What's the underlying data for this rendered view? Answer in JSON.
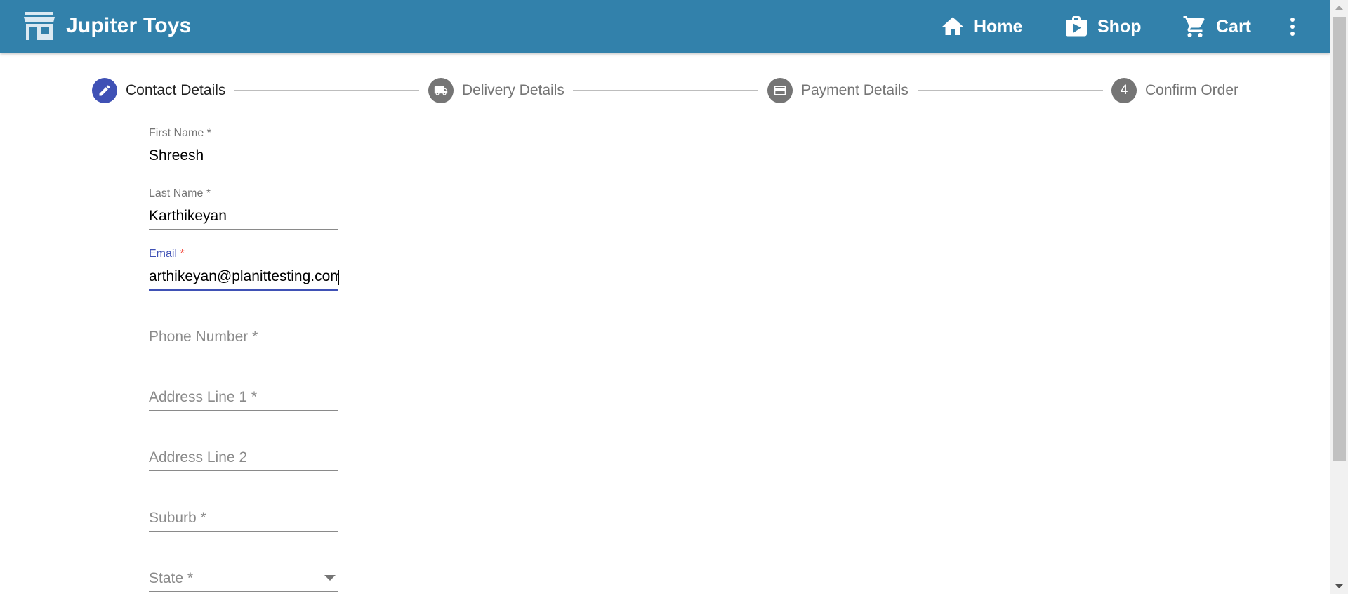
{
  "app": {
    "title": "Jupiter Toys",
    "brand_color": "#3281ab",
    "accent_color": "#3f51b5",
    "logo_icon": "store-icon"
  },
  "nav": {
    "items": [
      {
        "label": "Home",
        "icon": "home-icon"
      },
      {
        "label": "Shop",
        "icon": "shopping-bag-icon"
      },
      {
        "label": "Cart",
        "icon": "cart-icon"
      }
    ],
    "more_icon": "more-vert-icon"
  },
  "stepper": {
    "steps": [
      {
        "label": "Contact Details",
        "icon": "edit-icon",
        "state": "active"
      },
      {
        "label": "Delivery Details",
        "icon": "truck-icon",
        "state": "completed"
      },
      {
        "label": "Payment Details",
        "icon": "credit-card-icon",
        "state": "completed"
      },
      {
        "label": "Confirm Order",
        "number": "4",
        "state": "pending"
      }
    ]
  },
  "form": {
    "first_name": {
      "label": "First Name *",
      "value": "Shreesh"
    },
    "last_name": {
      "label": "Last Name *",
      "value": "Karthikeyan"
    },
    "email": {
      "label": "Email",
      "required_mark": " *",
      "value": "arthikeyan@planittesting.com"
    },
    "phone": {
      "placeholder": "Phone Number *"
    },
    "address1": {
      "placeholder": "Address Line 1 *"
    },
    "address2": {
      "placeholder": "Address Line 2"
    },
    "suburb": {
      "placeholder": "Suburb *"
    },
    "state": {
      "placeholder": "State *"
    }
  }
}
